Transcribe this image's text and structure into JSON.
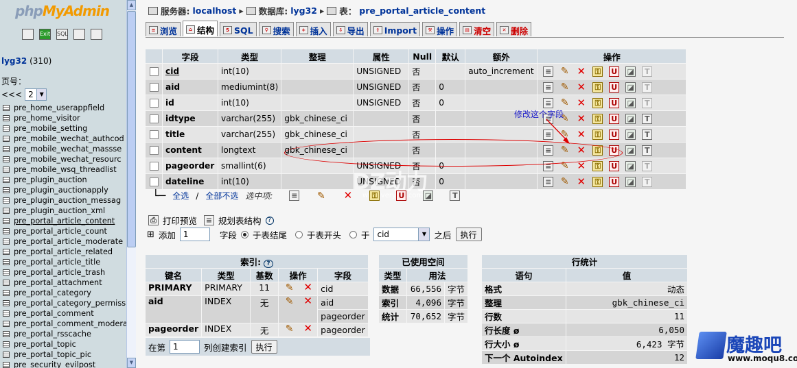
{
  "left": {
    "logo_a": "php",
    "logo_b": "MyAdmin",
    "icons": [
      "home-icon",
      "exit-icon",
      "sql-icon",
      "query-icon",
      "help-icon"
    ],
    "icon_labels": [
      "",
      "Exit",
      "SQL",
      "",
      ""
    ],
    "db_name": "lyg32",
    "db_count": "(310)",
    "page_label": "页号：",
    "page_prev": "<<<",
    "page_value": "2",
    "tables": [
      "pre_home_userappfield",
      "pre_home_visitor",
      "pre_mobile_setting",
      "pre_mobile_wechat_authcod",
      "pre_mobile_wechat_massse",
      "pre_mobile_wechat_resourc",
      "pre_mobile_wsq_threadlist",
      "pre_plugin_auction",
      "pre_plugin_auctionapply",
      "pre_plugin_auction_messag",
      "pre_plugin_auction_xml",
      "pre_portal_article_content",
      "pre_portal_article_count",
      "pre_portal_article_moderate",
      "pre_portal_article_related",
      "pre_portal_article_title",
      "pre_portal_article_trash",
      "pre_portal_attachment",
      "pre_portal_category",
      "pre_portal_category_permiss",
      "pre_portal_comment",
      "pre_portal_comment_modera",
      "pre_portal_rsscache",
      "pre_portal_topic",
      "pre_portal_topic_pic",
      "pre_security_evilpost"
    ],
    "current_index": 11
  },
  "breadcrumb": {
    "server_label": "服务器:",
    "server": "localhost",
    "db_label": "数据库:",
    "db": "lyg32",
    "table_label": "表：",
    "table": "pre_portal_article_content"
  },
  "tabs": [
    {
      "label": "浏览",
      "icon": "browse-icon",
      "active": false,
      "red": false
    },
    {
      "label": "结构",
      "icon": "structure-icon",
      "active": true,
      "red": false
    },
    {
      "label": "SQL",
      "icon": "sql-icon",
      "active": false,
      "red": false
    },
    {
      "label": "搜索",
      "icon": "search-icon",
      "active": false,
      "red": false
    },
    {
      "label": "插入",
      "icon": "insert-icon",
      "active": false,
      "red": false
    },
    {
      "label": "导出",
      "icon": "export-icon",
      "active": false,
      "red": false
    },
    {
      "label": "Import",
      "icon": "import-icon",
      "active": false,
      "red": false
    },
    {
      "label": "操作",
      "icon": "operations-icon",
      "active": false,
      "red": false
    },
    {
      "label": "清空",
      "icon": "empty-icon",
      "active": false,
      "red": true
    },
    {
      "label": "删除",
      "icon": "drop-icon",
      "active": false,
      "red": true
    }
  ],
  "fields": {
    "headers": [
      "字段",
      "类型",
      "整理",
      "属性",
      "Null",
      "默认",
      "额外",
      "操作"
    ],
    "rows": [
      {
        "name": "cid",
        "type": "int(10)",
        "collation": "",
        "attr": "UNSIGNED",
        "null": "否",
        "default": "",
        "extra": "auto_increment",
        "primary": true,
        "fulltext": false
      },
      {
        "name": "aid",
        "type": "mediumint(8)",
        "collation": "",
        "attr": "UNSIGNED",
        "null": "否",
        "default": "0",
        "extra": "",
        "primary": false,
        "fulltext": false
      },
      {
        "name": "id",
        "type": "int(10)",
        "collation": "",
        "attr": "UNSIGNED",
        "null": "否",
        "default": "0",
        "extra": "",
        "primary": false,
        "fulltext": false
      },
      {
        "name": "idtype",
        "type": "varchar(255)",
        "collation": "gbk_chinese_ci",
        "attr": "",
        "null": "否",
        "default": "",
        "extra": "",
        "primary": false,
        "fulltext": true
      },
      {
        "name": "title",
        "type": "varchar(255)",
        "collation": "gbk_chinese_ci",
        "attr": "",
        "null": "否",
        "default": "",
        "extra": "",
        "primary": false,
        "fulltext": true
      },
      {
        "name": "content",
        "type": "longtext",
        "collation": "gbk_chinese_ci",
        "attr": "",
        "null": "否",
        "default": "",
        "extra": "",
        "primary": false,
        "fulltext": true
      },
      {
        "name": "pageorder",
        "type": "smallint(6)",
        "collation": "",
        "attr": "UNSIGNED",
        "null": "否",
        "default": "0",
        "extra": "",
        "primary": false,
        "fulltext": false
      },
      {
        "name": "dateline",
        "type": "int(10)",
        "collation": "",
        "attr": "UNSIGNED",
        "null": "否",
        "default": "0",
        "extra": "",
        "primary": false,
        "fulltext": false
      }
    ]
  },
  "annotation": "修改这个字段",
  "select_bar": {
    "check_all": "全选",
    "sep": "/",
    "uncheck_all": "全部不选",
    "with_selected": "选中项:"
  },
  "links": {
    "print": "打印预览",
    "propose": "规划表结构"
  },
  "add_row": {
    "label": "添加",
    "count": "1",
    "field_label": "字段",
    "end": "于表结尾",
    "start": "于表开头",
    "after_pre": "于",
    "after_field": "cid",
    "after_post": "之后",
    "go": "执行"
  },
  "indexes": {
    "title": "索引:",
    "headers": [
      "键名",
      "类型",
      "基数",
      "操作",
      "字段"
    ],
    "rows": [
      {
        "key": "PRIMARY",
        "type": "PRIMARY",
        "card": "11",
        "field": "cid"
      },
      {
        "key": "aid",
        "type": "INDEX",
        "card": "无",
        "field": "aid",
        "field2": "pageorder"
      },
      {
        "key": "pageorder",
        "type": "INDEX",
        "card": "无",
        "field": "pageorder"
      }
    ],
    "create_pre": "在第",
    "create_count": "1",
    "create_post": "列创建索引",
    "go": "执行"
  },
  "space": {
    "title": "已使用空间",
    "headers": [
      "类型",
      "用法"
    ],
    "rows": [
      {
        "type": "数据",
        "value": "66,556",
        "unit": "字节"
      },
      {
        "type": "索引",
        "value": "4,096",
        "unit": "字节"
      },
      {
        "type": "统计",
        "value": "70,652",
        "unit": "字节"
      }
    ]
  },
  "stats": {
    "title": "行统计",
    "headers": [
      "语句",
      "值"
    ],
    "rows": [
      {
        "label": "格式",
        "value": "动态"
      },
      {
        "label": "整理",
        "value": "gbk_chinese_ci"
      },
      {
        "label": "行数",
        "value": "11"
      },
      {
        "label": "行长度 ø",
        "value": "6,050"
      },
      {
        "label": "行大小 ø",
        "value": "6,423 字节"
      },
      {
        "label": "下一个 Autoindex",
        "value": "12"
      }
    ]
  },
  "watermark": {
    "main": "DZ动力",
    "url": "www.veryd z.com"
  },
  "brand": {
    "name": "魔趣吧",
    "url": "www.moqu8.com"
  }
}
